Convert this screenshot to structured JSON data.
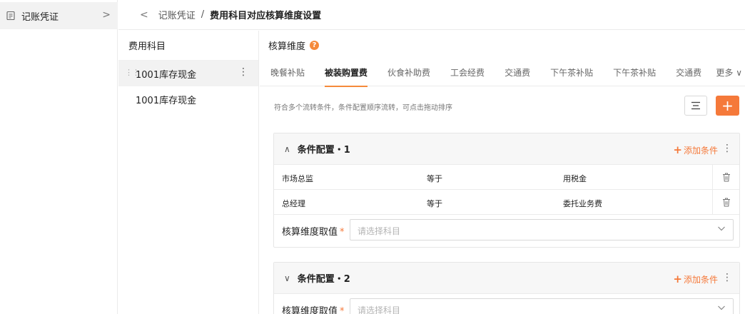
{
  "nav": {
    "item_label": "记账凭证"
  },
  "header": {
    "crumb_parent": "记账凭证",
    "separator": "/",
    "crumb_current": "费用科目对应核算维度设置"
  },
  "subject_panel": {
    "title": "费用科目",
    "items": [
      {
        "label": "1001库存现金"
      },
      {
        "label": "1001库存现金"
      }
    ]
  },
  "main": {
    "title": "核算维度",
    "help_icon": "?",
    "tabs": [
      "晚餐补贴",
      "被装购置费",
      "伙食补助费",
      "工会经费",
      "交通费",
      "下午茶补贴",
      "下午茶补贴",
      "交通费"
    ],
    "active_tab_index": 1,
    "more_label": "更多",
    "hint": "符合多个流转条件，条件配置顺序流转，可点击拖动排序",
    "add_symbol": "+",
    "conditions": [
      {
        "title": "条件配置・1",
        "expanded": true,
        "toggle": "∧",
        "add_label": "添加条件",
        "rows": [
          {
            "field": "市场总监",
            "operator": "等于",
            "value": "用税金"
          },
          {
            "field": "总经理",
            "operator": "等于",
            "value": "委托业务费"
          }
        ],
        "value_label": "核算维度取值",
        "required_mark": "*",
        "placeholder": "请选择科目"
      },
      {
        "title": "条件配置・2",
        "expanded": false,
        "toggle": "∨",
        "add_label": "添加条件",
        "rows": [],
        "value_label": "核算维度取值",
        "required_mark": "*",
        "placeholder": "请选择科目"
      }
    ]
  },
  "colors": {
    "accent": "#f5793a",
    "selected_bg": "#f2f2f2"
  },
  "icons": {
    "nav": "document-icon",
    "sort": "sort-lines-icon",
    "delete": "trash-icon",
    "dropdown": "chevron-down-icon"
  }
}
